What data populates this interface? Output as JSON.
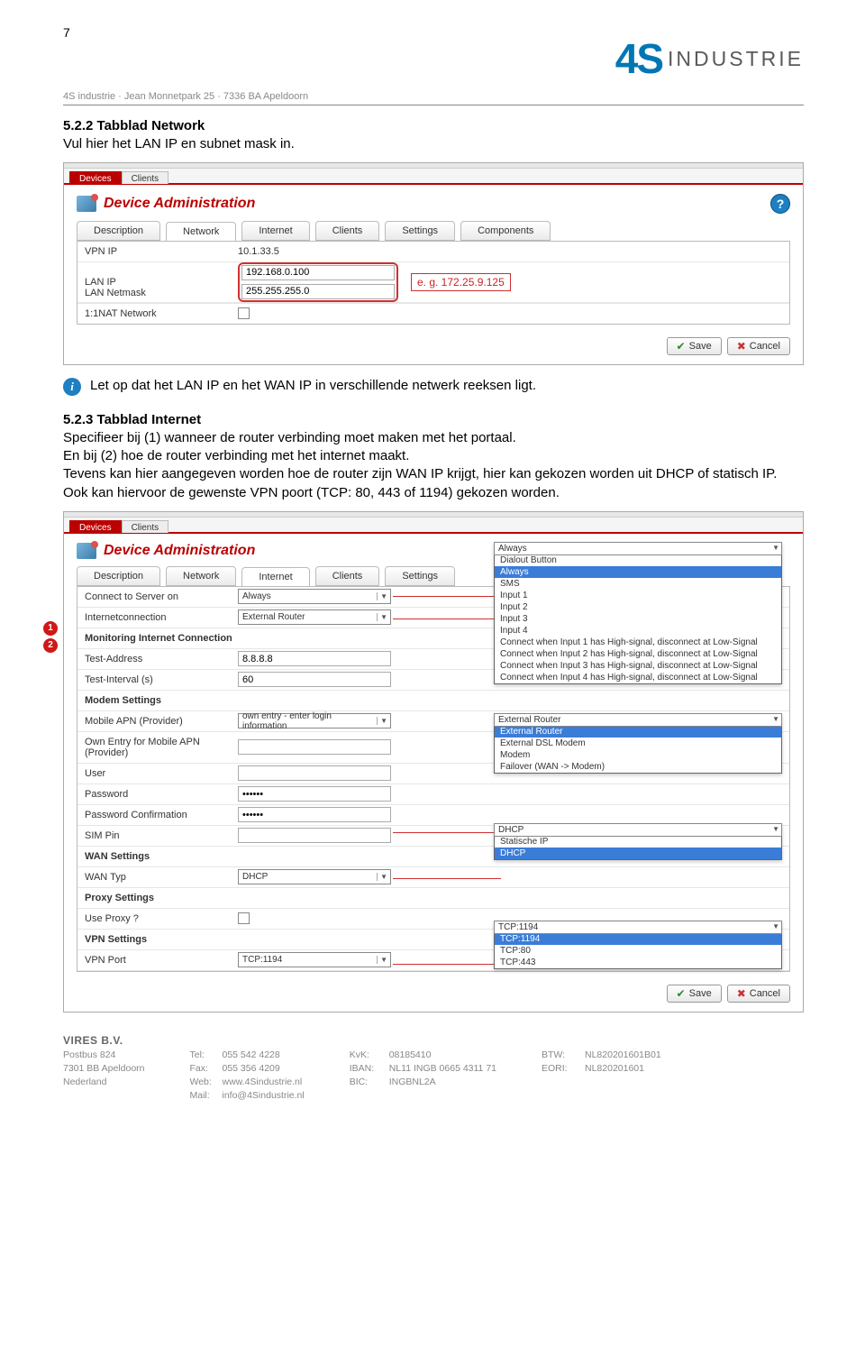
{
  "page_number": "7",
  "logo": {
    "brand": "4S",
    "word": "INDUSTRIE"
  },
  "address_line": "4S industrie · Jean Monnetpark 25 · 7336 BA Apeldoorn",
  "s522": {
    "heading": "5.2.2 Tabblad Network",
    "intro": "Vul hier het LAN IP en subnet mask in."
  },
  "shot1": {
    "top_tabs": [
      "Devices",
      "Clients"
    ],
    "title": "Device Administration",
    "inner_tabs": [
      "Description",
      "Network",
      "Internet",
      "Clients",
      "Settings",
      "Components"
    ],
    "rows": {
      "vpn_ip": {
        "label": "VPN IP",
        "value": "10.1.33.5"
      },
      "lan_ip": {
        "label": "LAN IP",
        "value": "192.168.0.100"
      },
      "lan_netmask": {
        "label": "LAN Netmask",
        "value": "255.255.255.0"
      },
      "nat": {
        "label": "1:1NAT Network"
      }
    },
    "hint": "e. g. 172.25.9.125",
    "save": "Save",
    "cancel": "Cancel"
  },
  "info_note": "Let op dat het LAN IP en het WAN IP in verschillende netwerk reeksen ligt.",
  "s523": {
    "heading": "5.2.3 Tabblad Internet",
    "body": "Specifieer bij (1) wanneer de router verbinding moet maken met het portaal.\nEn bij (2) hoe de router verbinding met het internet maakt.\nTevens kan hier aangegeven worden hoe de router zijn WAN IP krijgt, hier kan gekozen worden uit DHCP of statisch IP. Ook kan hiervoor de gewenste VPN poort (TCP: 80, 443 of 1194) gekozen worden."
  },
  "shot2": {
    "top_tabs": [
      "Devices",
      "Clients"
    ],
    "title": "Device Administration",
    "inner_tabs": [
      "Description",
      "Network",
      "Internet",
      "Clients",
      "Settings"
    ],
    "rows": {
      "connect": {
        "label": "Connect to Server on",
        "value": "Always"
      },
      "iconn": {
        "label": "Internetconnection",
        "value": "External Router"
      },
      "mon_head": "Monitoring Internet Connection",
      "test_addr": {
        "label": "Test-Address",
        "value": "8.8.8.8"
      },
      "test_int": {
        "label": "Test-Interval (s)",
        "value": "60"
      },
      "modem_head": "Modem Settings",
      "apn": {
        "label": "Mobile APN (Provider)",
        "value": "own entry - enter login information"
      },
      "own_apn": {
        "label": "Own Entry for Mobile APN (Provider)",
        "value": ""
      },
      "user": {
        "label": "User",
        "value": ""
      },
      "pwd": {
        "label": "Password",
        "value": "••••••"
      },
      "pwd2": {
        "label": "Password Confirmation",
        "value": "••••••"
      },
      "sim": {
        "label": "SIM Pin",
        "value": ""
      },
      "wan_head": "WAN Settings",
      "wan_typ": {
        "label": "WAN Typ",
        "value": "DHCP"
      },
      "proxy_head": "Proxy Settings",
      "use_proxy": {
        "label": "Use Proxy ?"
      },
      "vpn_head": "VPN Settings",
      "vpn_port": {
        "label": "VPN Port",
        "value": "TCP:1194"
      }
    },
    "dd_connect": {
      "head": "Always",
      "items": [
        "Dialout Button",
        "Always",
        "SMS",
        "Input 1",
        "Input 2",
        "Input 3",
        "Input 4",
        "Connect when Input 1 has High-signal, disconnect at Low-Signal",
        "Connect when Input 2 has High-signal, disconnect at Low-Signal",
        "Connect when Input 3 has High-signal, disconnect at Low-Signal",
        "Connect when Input 4 has High-signal, disconnect at Low-Signal"
      ],
      "selected": "Always"
    },
    "dd_iconn": {
      "head": "External Router",
      "items": [
        "External Router",
        "External DSL Modem",
        "Modem",
        "Failover (WAN -> Modem)"
      ],
      "selected": "External Router"
    },
    "dd_wan": {
      "head": "DHCP",
      "items": [
        "Statische IP",
        "DHCP"
      ],
      "selected": "DHCP"
    },
    "dd_vpn": {
      "head": "TCP:1194",
      "items": [
        "TCP:1194",
        "TCP:80",
        "TCP:443"
      ],
      "selected": "TCP:1194"
    },
    "save": "Save",
    "cancel": "Cancel"
  },
  "footer": {
    "title": "VIRES B.V.",
    "col1": [
      "Postbus 824",
      "7301 BB Apeldoorn",
      "Nederland"
    ],
    "col2": [
      {
        "k": "Tel:",
        "v": "055 542 4228"
      },
      {
        "k": "Fax:",
        "v": "055 356 4209"
      },
      {
        "k": "Web:",
        "v": "www.4Sindustrie.nl"
      },
      {
        "k": "Mail:",
        "v": "info@4Sindustrie.nl"
      }
    ],
    "col3": [
      {
        "k": "KvK:",
        "v": "08185410"
      },
      {
        "k": "IBAN:",
        "v": "NL11 INGB 0665 4311 71"
      },
      {
        "k": "BIC:",
        "v": "INGBNL2A"
      }
    ],
    "col4": [
      {
        "k": "BTW:",
        "v": "NL820201601B01"
      },
      {
        "k": "EORI:",
        "v": "NL820201601"
      }
    ]
  }
}
